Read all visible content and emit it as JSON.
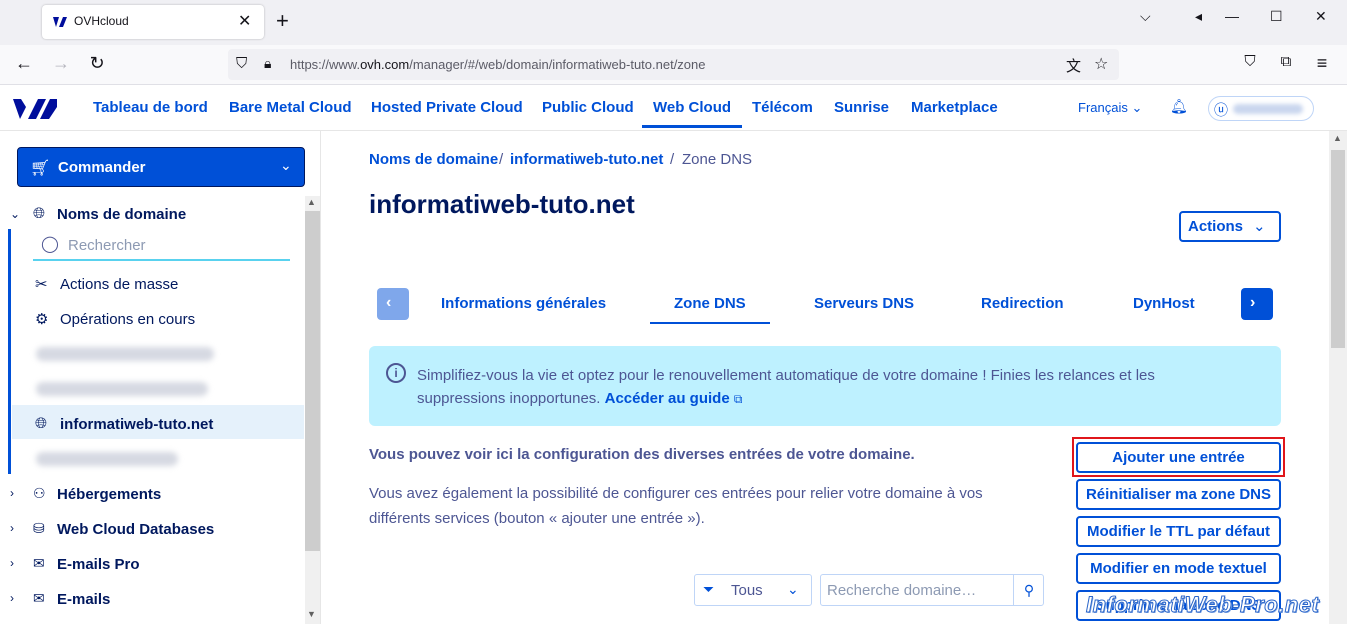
{
  "browser": {
    "tab_title": "OVHcloud",
    "url_prefix": "https://www.",
    "url_domain": "ovh.com",
    "url_path": "/manager/#/web/domain/informatiweb-tuto.net/zone"
  },
  "header": {
    "menu": [
      "Tableau de bord",
      "Bare Metal Cloud",
      "Hosted Private Cloud",
      "Public Cloud",
      "Web Cloud",
      "Télécom",
      "Sunrise",
      "Marketplace"
    ],
    "language": "Français"
  },
  "sidebar": {
    "commander_label": "Commander",
    "section_domains": "Noms de domaine",
    "search_placeholder": "Rechercher",
    "actions_masse": "Actions de masse",
    "operations": "Opérations en cours",
    "selected_domain": "informatiweb-tuto.net",
    "hebergements": "Hébergements",
    "databases": "Web Cloud Databases",
    "emails_pro": "E-mails Pro",
    "emails": "E-mails"
  },
  "main": {
    "breadcrumb": [
      "Noms de domaine",
      "informatiweb-tuto.net",
      "Zone DNS"
    ],
    "title": "informatiweb-tuto.net",
    "actions_label": "Actions",
    "tabs": [
      "Informations générales",
      "Zone DNS",
      "Serveurs DNS",
      "Redirection",
      "DynHost"
    ],
    "banner_text": "Simplifiez-vous la vie et optez pour le renouvellement automatique de votre domaine ! Finies les relances et les suppressions inopportunes. ",
    "banner_link": "Accéder au guide",
    "intro": "Vous pouvez voir ici la configuration des diverses entrées de votre domaine.",
    "description": "Vous avez également la possibilité de configurer ces entrées pour relier votre domaine à vos différents services (bouton « ajouter une entrée »).",
    "buttons": [
      "Ajouter une entrée",
      "Réinitialiser ma zone DNS",
      "Modifier le TTL par défaut",
      "Modifier en mode textuel",
      "Supprimer la zone DNS"
    ],
    "filter_value": "Tous",
    "search_placeholder": "Recherche domaine…"
  },
  "watermark": "InformatiWeb-Pro.net",
  "colors": {
    "primary": "#0050d7",
    "dark": "#00185e",
    "banner": "#bef1ff",
    "highlight": "#e0161b"
  }
}
